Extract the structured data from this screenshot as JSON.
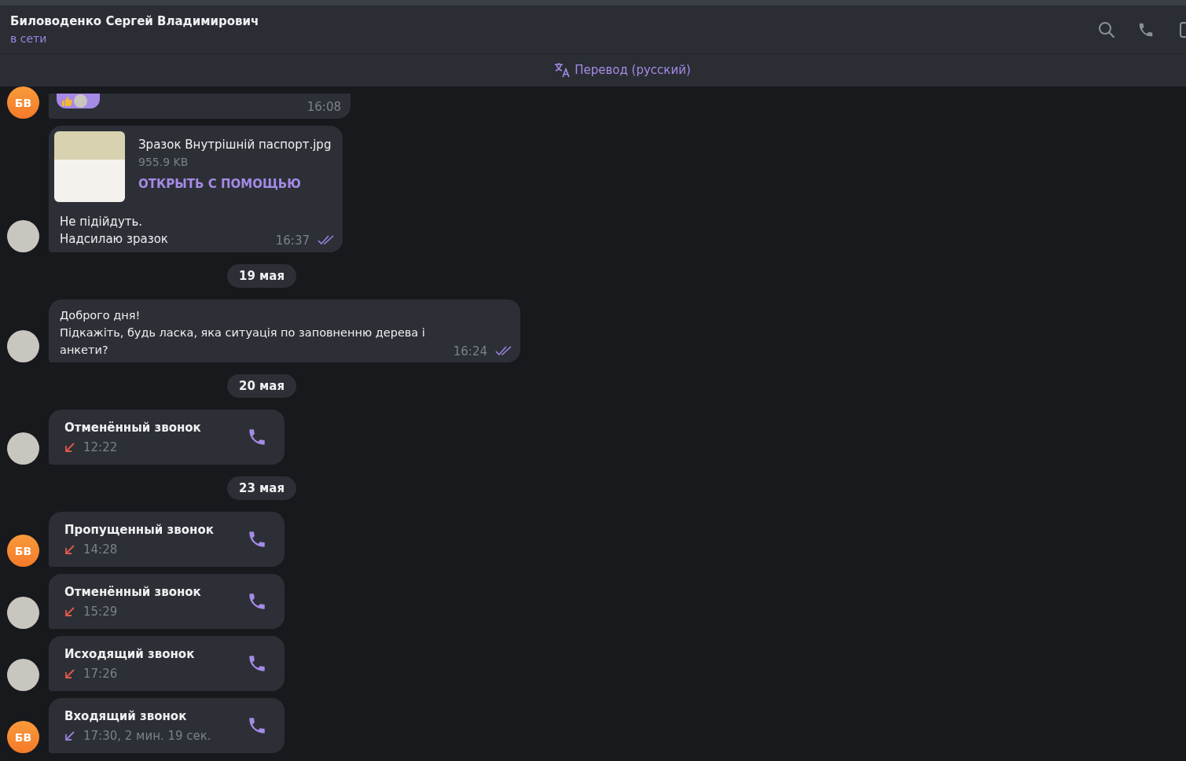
{
  "header": {
    "title": "Биловоденко Сергей Владимирович",
    "status": "в сети"
  },
  "translate_bar": {
    "label": "Перевод (русский)"
  },
  "messages": [
    {
      "kind": "reaction",
      "avatar": {
        "kind": "initials",
        "initials": "БВ"
      },
      "time": "16:08"
    },
    {
      "kind": "file",
      "avatar": {
        "kind": "photo"
      },
      "file_name": "Зразок Внутрішній паспорт.jpg",
      "file_size": "955.9 KB",
      "action": "ОТКРЫТЬ С ПОМОЩЬЮ",
      "lines": [
        "Не підійдуть.",
        "Надсилаю зразок"
      ],
      "time": "16:37",
      "read": true
    },
    {
      "kind": "date",
      "label": "19 мая"
    },
    {
      "kind": "text",
      "avatar": {
        "kind": "photo"
      },
      "lines": [
        "Доброго дня!",
        "Підкажіть, будь ласка, яка ситуація по заповненню дерева  і анкети?"
      ],
      "time": "16:24",
      "read": true
    },
    {
      "kind": "date",
      "label": "20 мая"
    },
    {
      "kind": "call",
      "avatar": {
        "kind": "photo"
      },
      "title": "Отменённый звонок",
      "info": "12:22",
      "color": "#e0584a"
    },
    {
      "kind": "date",
      "label": "23 мая"
    },
    {
      "kind": "call",
      "avatar": {
        "kind": "initials",
        "initials": "БВ"
      },
      "title": "Пропущенный звонок",
      "info": "14:28",
      "color": "#e0584a"
    },
    {
      "kind": "call",
      "avatar": {
        "kind": "photo"
      },
      "title": "Отменённый звонок",
      "info": "15:29",
      "color": "#e0584a"
    },
    {
      "kind": "call",
      "avatar": {
        "kind": "photo"
      },
      "title": "Исходящий звонок",
      "info": "17:26",
      "color": "#e0584a"
    },
    {
      "kind": "call",
      "avatar": {
        "kind": "initials",
        "initials": "БВ"
      },
      "title": "Входящий звонок",
      "info": "17:30, 2 мин. 19 сек.",
      "color": "#9a7fe0"
    }
  ]
}
